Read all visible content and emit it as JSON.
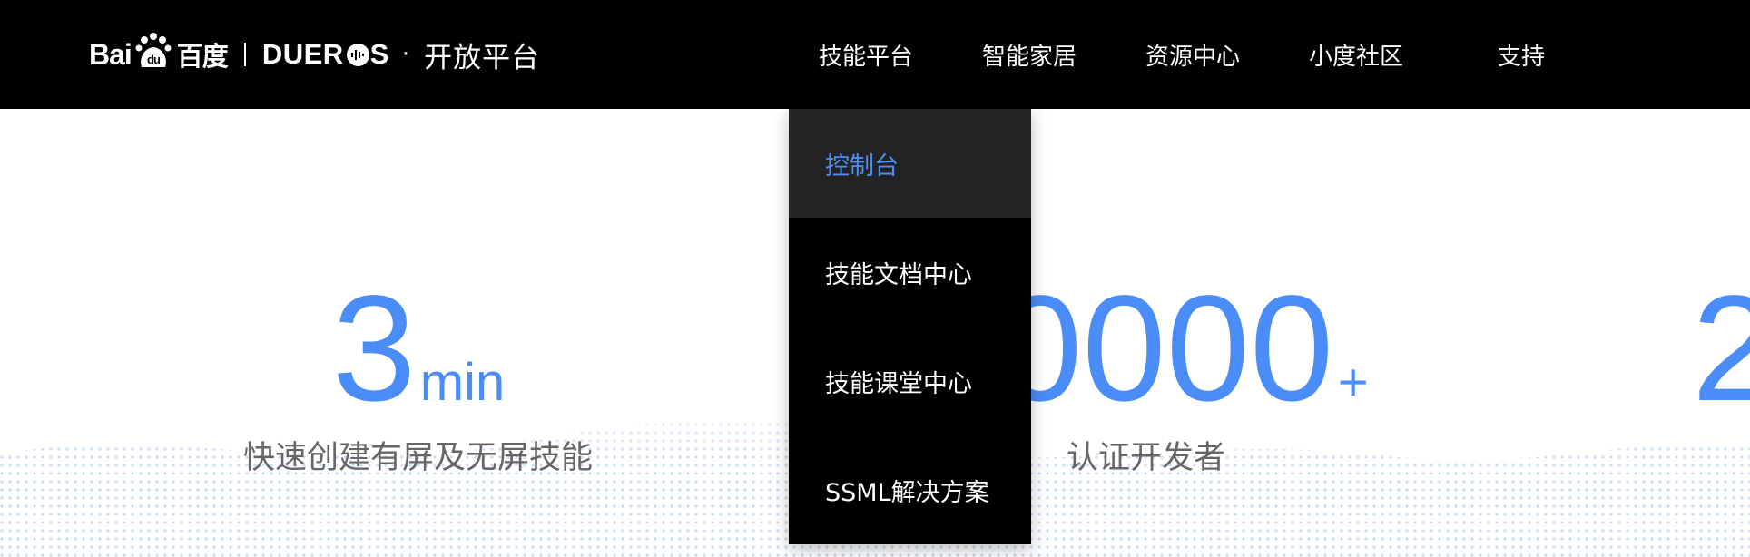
{
  "header": {
    "logo": {
      "baidu_text": "Bai",
      "baidu_du": "du",
      "baidu_cn": "百度",
      "dueros_text": "DUER",
      "dueros_s": "S",
      "dot": "·",
      "platform": "开放平台"
    },
    "nav": [
      {
        "label": "技能平台"
      },
      {
        "label": "智能家居"
      },
      {
        "label": "资源中心"
      },
      {
        "label": "小度社区"
      },
      {
        "label": "支持"
      }
    ]
  },
  "dropdown": {
    "items": [
      {
        "label": "控制台",
        "active": true
      },
      {
        "label": "技能文档中心"
      },
      {
        "label": "技能课堂中心"
      },
      {
        "label": "SSML解决方案"
      }
    ]
  },
  "stats": [
    {
      "value": "3",
      "unit": "min",
      "label": "快速创建有屏及无屏技能"
    },
    {
      "value": "0000",
      "unit": "+",
      "label": "认证开发者"
    },
    {
      "value": "2"
    }
  ],
  "colors": {
    "accent": "#4a8df8",
    "header_bg": "#000000",
    "dropdown_active_bg": "#232323"
  }
}
